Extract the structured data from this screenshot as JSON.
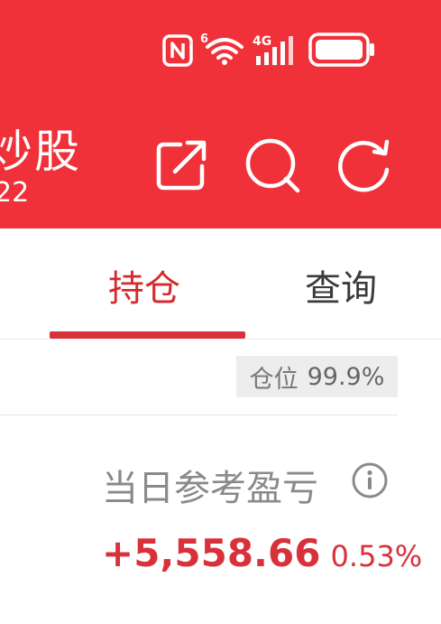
{
  "status_bar": {
    "network_label": "4G",
    "wifi_badge": "6"
  },
  "header": {
    "title": "炒股",
    "subtitle": "22"
  },
  "tabs": [
    {
      "label": "持仓",
      "active": true
    },
    {
      "label": "查询",
      "active": false
    }
  ],
  "position": {
    "label": "仓位",
    "value": "99.9%"
  },
  "daily_pnl": {
    "label": "当日参考盈亏",
    "amount": "+5,558.66",
    "percent": "0.53%"
  },
  "colors": {
    "header_bg": "#f0313a",
    "accent_red": "#d8313a",
    "badge_bg": "#ededed"
  },
  "icons": [
    "nfc-icon",
    "wifi-icon",
    "signal-icon",
    "battery-icon",
    "share-icon",
    "search-icon",
    "refresh-icon",
    "info-icon"
  ]
}
